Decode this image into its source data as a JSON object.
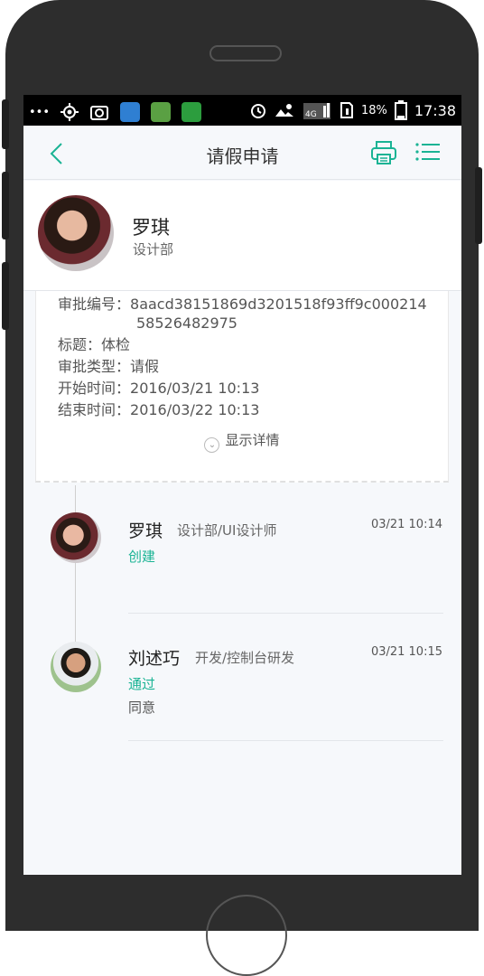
{
  "status_bar": {
    "left_icons": [
      "dots-icon",
      "locate-icon",
      "screenshot-icon",
      "weather-app-icon",
      "flower-app-icon",
      "shield-app-icon"
    ],
    "battery": "18%",
    "time": "17:38"
  },
  "nav": {
    "title": "请假申请"
  },
  "profile": {
    "name": "罗琪",
    "department": "设计部"
  },
  "details": {
    "approval_no_label": "审批编号：",
    "approval_no_line1": "8aacd38151869d3201518f93ff9c000214",
    "approval_no_line2": "58526482975",
    "title_label": "标题：",
    "title_value": "体检",
    "type_label": "审批类型：",
    "type_value": "请假",
    "start_label": "开始时间：",
    "start_value": "2016/03/21 10:13",
    "end_label": "结束时间：",
    "end_value": "2016/03/22 10:13",
    "show_more": "显示详情"
  },
  "timeline": [
    {
      "name": "罗琪",
      "role": "设计部/UI设计师",
      "time": "03/21 10:14",
      "status": "创建",
      "comment": ""
    },
    {
      "name": "刘述巧",
      "role": "开发/控制台研发",
      "time": "03/21 10:15",
      "status": "通过",
      "comment": "同意"
    }
  ],
  "colors": {
    "accent": "#1ab394",
    "background": "#f6f8fb"
  }
}
